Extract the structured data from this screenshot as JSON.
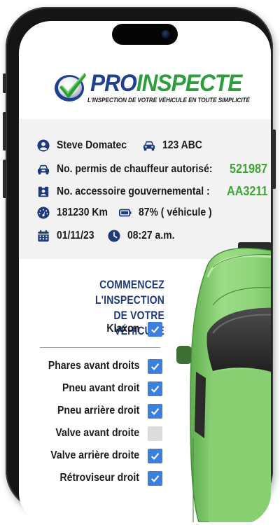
{
  "brand": {
    "name_part1": "PRO",
    "name_part2": "INSPECTE",
    "tagline": "L'INSPECTION DE VOTRE VÉHICULE EN TOUTE SIMPLICITÉ"
  },
  "info": {
    "driver_name": "Steve Domatec",
    "plate": "123 ABC",
    "permit_label": "No. permis de chauffeur autorisé:",
    "permit_number": "521987",
    "accessory_label": "No. accessoire gouvernemental :",
    "accessory_number": "AA3211",
    "odometer": "181230 Km",
    "battery": "87% ( véhicule )",
    "date": "01/11/23",
    "time": "08:27 a.m."
  },
  "checklist": {
    "heading_line1": "COMMENCEZ L'INSPECTION",
    "heading_line2": "DE VOTRE VÉHICULE",
    "items": [
      {
        "label": "Klaxon",
        "checked": true
      },
      {
        "label": "Phares avant droits",
        "checked": true
      },
      {
        "label": "Pneu avant droit",
        "checked": true
      },
      {
        "label": "Pneu arrière droit",
        "checked": true
      },
      {
        "label": "Valve avant droite",
        "checked": false
      },
      {
        "label": "Valve arrière droite",
        "checked": true
      },
      {
        "label": "Rétroviseur droit",
        "checked": true
      }
    ]
  },
  "colors": {
    "brand_blue": "#1f3f91",
    "brand_green": "#2c9f3c",
    "checkbox_checked": "#3d7fe0",
    "checkbox_unchecked": "#dcdcdc",
    "car_green": "#8fd47a"
  },
  "icons": [
    "user-icon",
    "car-icon",
    "steering-wheel-icon",
    "id-badge-icon",
    "speedometer-icon",
    "battery-icon",
    "calendar-icon",
    "clock-icon",
    "check-icon"
  ]
}
